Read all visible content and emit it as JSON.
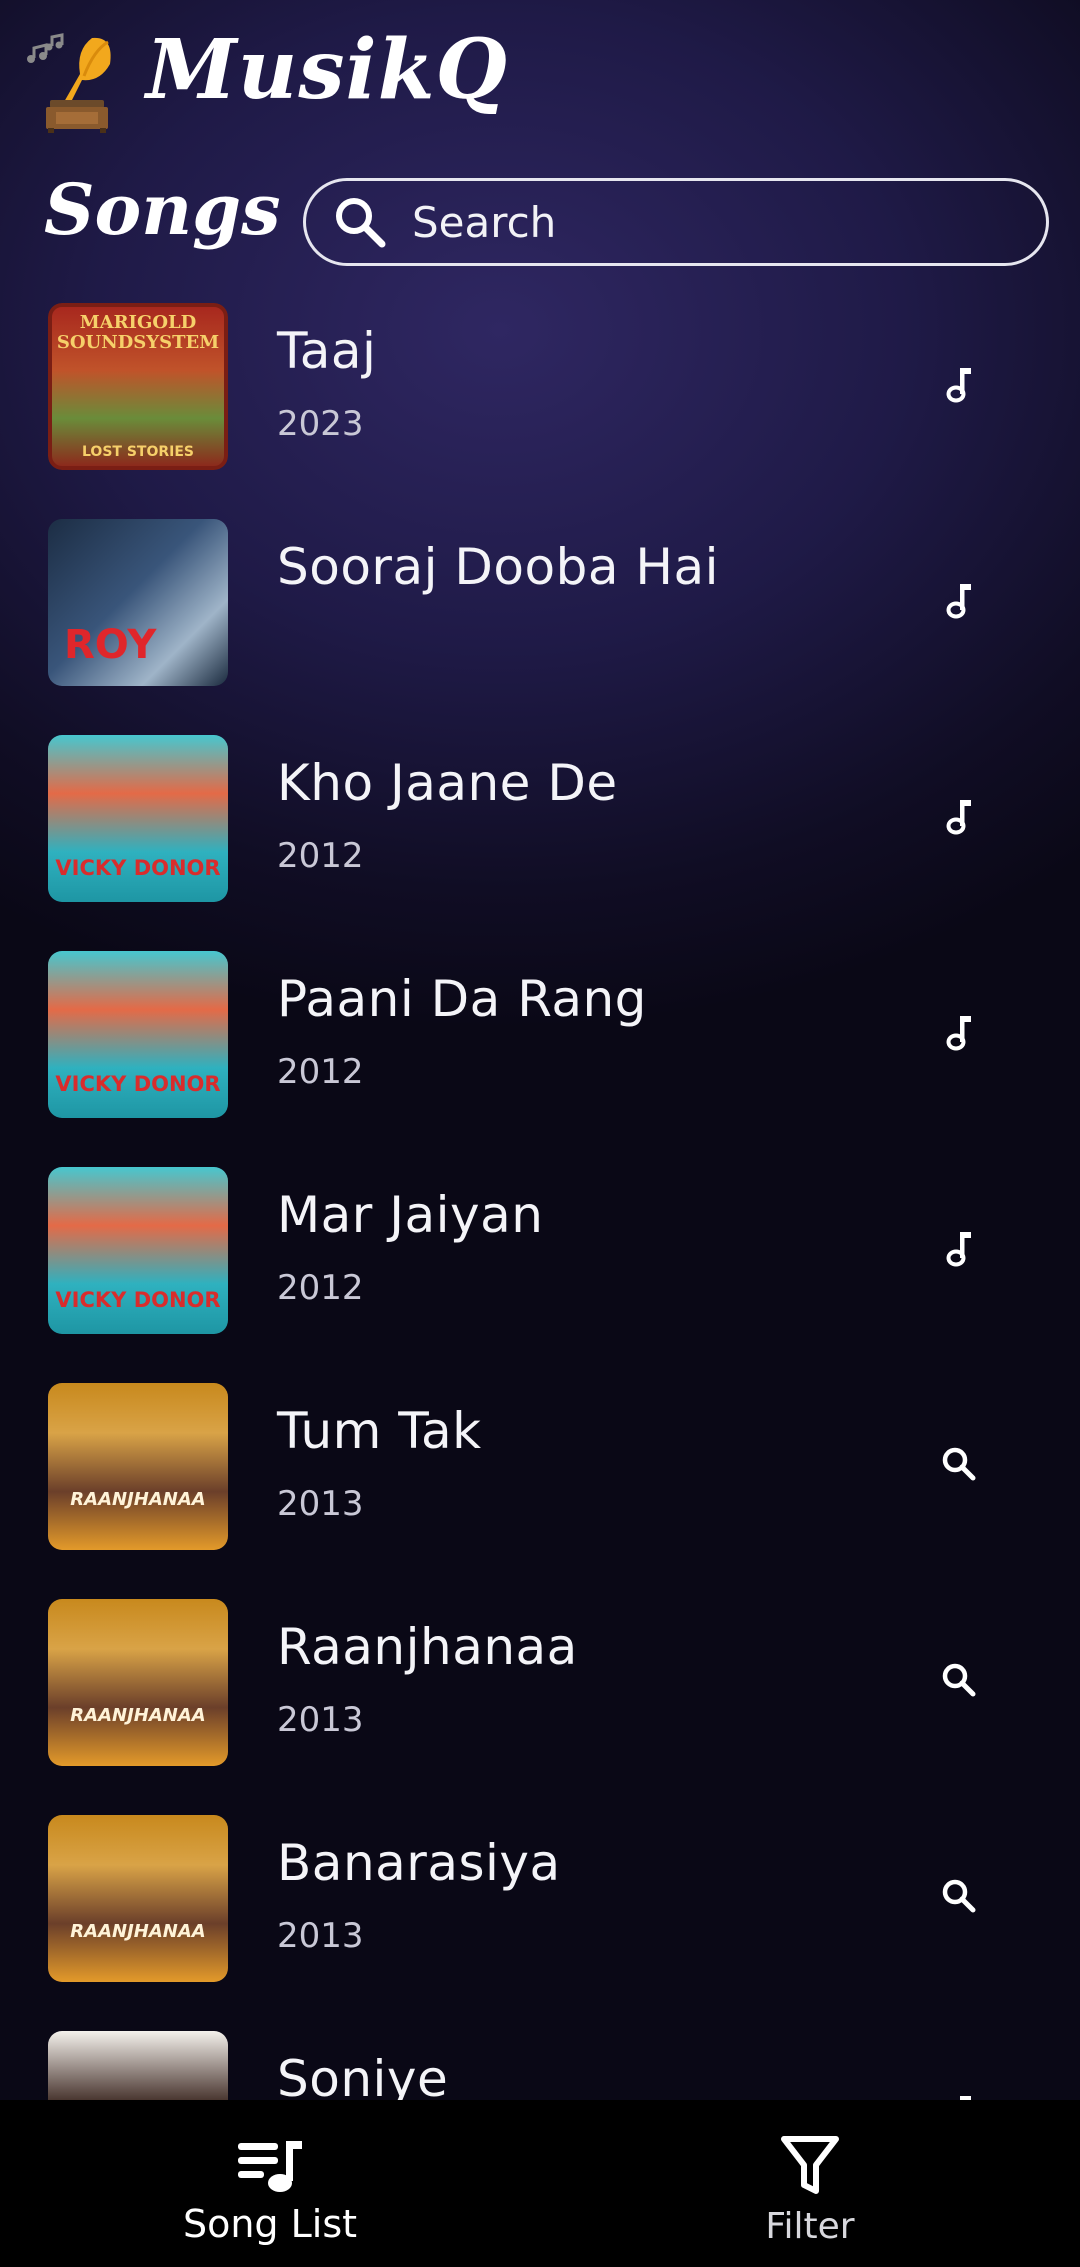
{
  "app": {
    "brand": "MusikQ"
  },
  "header": {
    "section_title": "Songs"
  },
  "search": {
    "placeholder": "Search"
  },
  "songs": [
    {
      "title": "Taaj",
      "year": "2023",
      "icon": "music-note-icon",
      "cover": "marigold",
      "cover_text": "MARIGOLD SOUNDSYSTEM",
      "cover_sub": "LOST STORIES"
    },
    {
      "title": "Sooraj Dooba Hai",
      "year": "",
      "icon": "music-note-icon",
      "cover": "roy",
      "cover_text": "ROY"
    },
    {
      "title": "Kho Jaane De",
      "year": "2012",
      "icon": "music-note-icon",
      "cover": "vicky",
      "cover_text": "VICKY DONOR"
    },
    {
      "title": "Paani Da Rang",
      "year": "2012",
      "icon": "music-note-icon",
      "cover": "vicky",
      "cover_text": "VICKY DONOR"
    },
    {
      "title": "Mar Jaiyan",
      "year": "2012",
      "icon": "music-note-icon",
      "cover": "vicky",
      "cover_text": "VICKY DONOR"
    },
    {
      "title": "Tum Tak",
      "year": "2013",
      "icon": "search-icon",
      "cover": "raanjhanaa",
      "cover_text": "RAANJHANAA"
    },
    {
      "title": "Raanjhanaa",
      "year": "2013",
      "icon": "search-icon",
      "cover": "raanjhanaa",
      "cover_text": "RAANJHANAA"
    },
    {
      "title": "Banarasiya",
      "year": "2013",
      "icon": "search-icon",
      "cover": "raanjhanaa",
      "cover_text": "RAANJHANAA"
    },
    {
      "title": "Soniye",
      "year": "",
      "icon": "music-note-icon",
      "cover": "soniye",
      "cover_text": ""
    }
  ],
  "bottom_nav": {
    "items": [
      {
        "label": "Song List",
        "icon": "playlist-music-icon",
        "active": true
      },
      {
        "label": "Filter",
        "icon": "filter-icon",
        "active": false
      }
    ]
  },
  "colors": {
    "background_top": "#2f2762",
    "background_bottom": "#0a0816",
    "nav_background": "#000000",
    "text_primary": "#f4f4f8",
    "text_secondary": "#c9c8d6"
  }
}
